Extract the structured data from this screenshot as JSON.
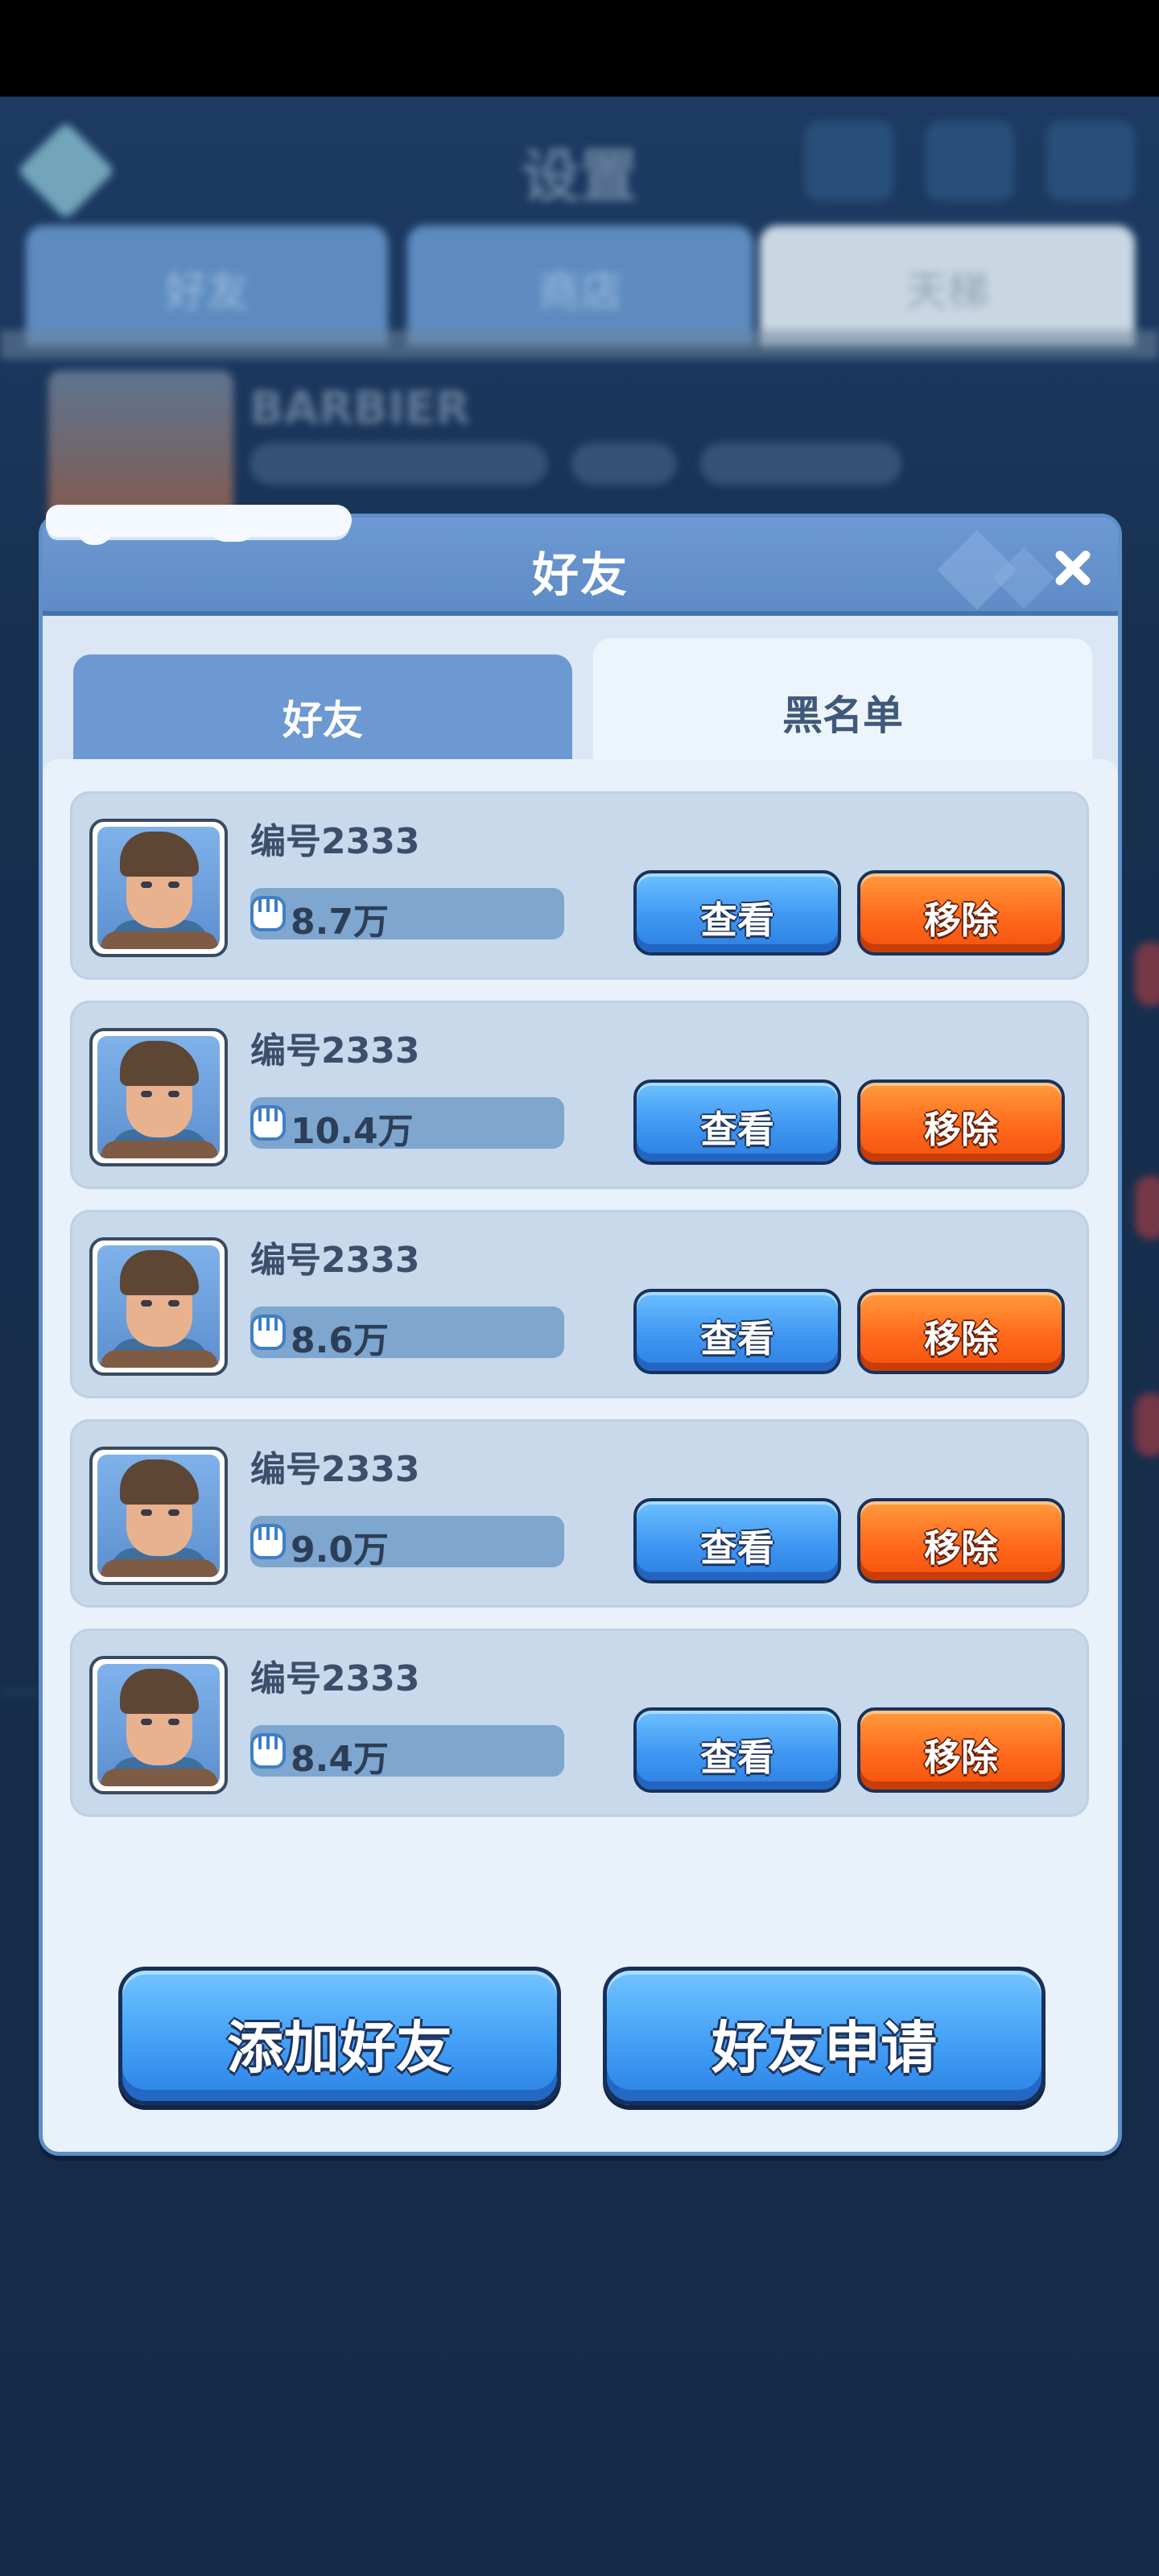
{
  "background": {
    "title": "设置",
    "tabs": [
      "好友",
      "商店",
      "天梯"
    ],
    "player_name": "BARBIER"
  },
  "dialog": {
    "title": "好友",
    "tabs": {
      "friends": "好友",
      "blacklist": "黑名单"
    },
    "active_tab": "黑名单",
    "rows": [
      {
        "name": "编号2333",
        "power": "8.7万",
        "view": "查看",
        "remove": "移除"
      },
      {
        "name": "编号2333",
        "power": "10.4万",
        "view": "查看",
        "remove": "移除"
      },
      {
        "name": "编号2333",
        "power": "8.6万",
        "view": "查看",
        "remove": "移除"
      },
      {
        "name": "编号2333",
        "power": "9.0万",
        "view": "查看",
        "remove": "移除"
      },
      {
        "name": "编号2333",
        "power": "8.4万",
        "view": "查看",
        "remove": "移除"
      }
    ],
    "add_friend": "添加好友",
    "friend_requests": "好友申请"
  },
  "colors": {
    "view_button": "#3f97f2",
    "remove_button": "#ff6a1d",
    "header": "#6c99d2"
  },
  "icons": [
    "close-icon",
    "fist-icon",
    "avatar-portrait"
  ]
}
